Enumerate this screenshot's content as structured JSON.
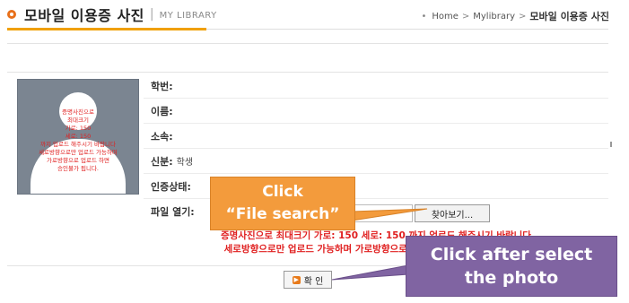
{
  "header": {
    "title": "모바일 이용증 사진",
    "subtitle": "MY LIBRARY",
    "breadcrumb": [
      "Home",
      "Mylibrary",
      "모바일 이용증 사진"
    ]
  },
  "photo_note": [
    "증명사진으로",
    "최대크기",
    "가로: 150",
    "세로: 150",
    "까지 업로드 해주시기 바랍니다",
    "세로방향으로만 업로드 가능하며",
    "가로방향으로 업로드 하면",
    "승인불가 됩니다."
  ],
  "form": {
    "student_id_label": "학번:",
    "name_label": "이름:",
    "department_label": "소속:",
    "status_label": "신분:",
    "status_value": "학생",
    "approval_label": "인증상태:",
    "file_label": "파일 열기:",
    "file_value": "",
    "search_button": "찾아보기..."
  },
  "notes": [
    "증명사진으로 최대크기 가로: 150 세로: 150 까지 업로드 해주시기 바랍니다",
    "세로방향으로만 업로드 가능하며 가로방향으로 업로드 하면 승인불가 됩니다."
  ],
  "confirm_button": "확 인",
  "callouts": {
    "file_search": [
      "Click",
      "“File search”"
    ],
    "after_select": [
      "Click after select",
      "the photo"
    ]
  },
  "colors": {
    "accent_orange": "#f0a000",
    "callout_orange": "#f39b3c",
    "callout_purple": "#8064a2",
    "note_red": "#e02020"
  },
  "icons": [
    "circle-icon",
    "person-silhouette-icon",
    "confirm-arrow-icon"
  ]
}
